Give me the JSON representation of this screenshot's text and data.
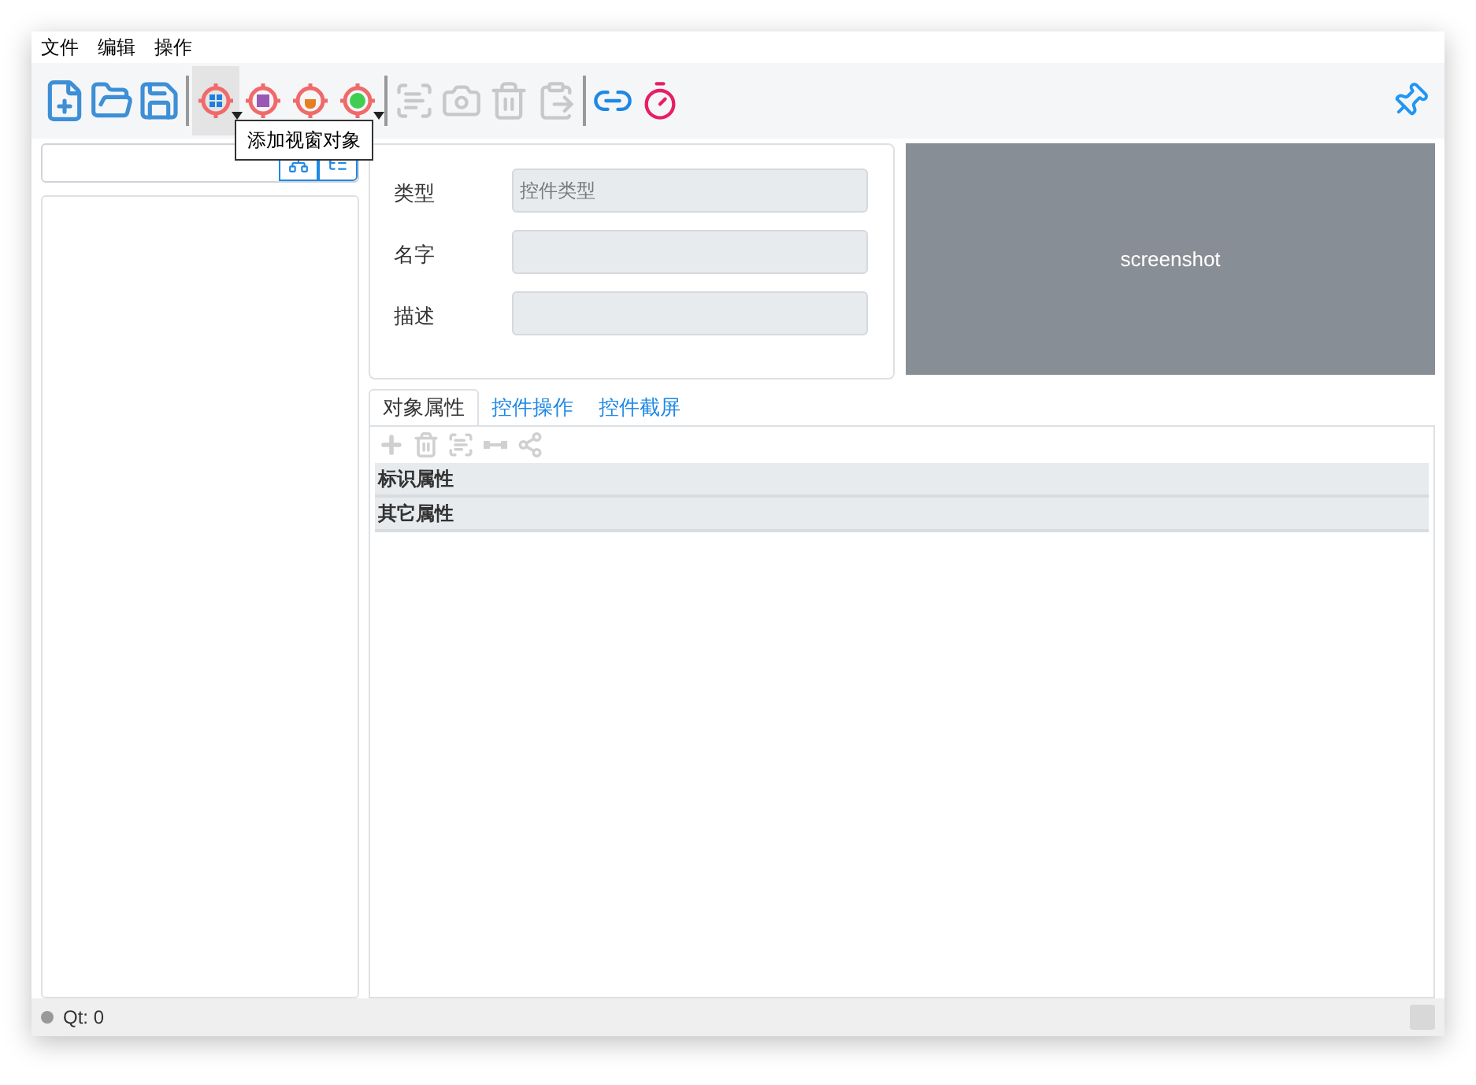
{
  "menu": [
    "文件",
    "编辑",
    "操作"
  ],
  "toolbar": [
    {
      "kind": "new",
      "disabled": false,
      "selected": false,
      "dropdown": false
    },
    {
      "kind": "open",
      "disabled": false,
      "selected": false,
      "dropdown": false
    },
    {
      "kind": "save",
      "disabled": false,
      "selected": false,
      "dropdown": false
    },
    {
      "kind": "separator"
    },
    {
      "kind": "target-window",
      "disabled": false,
      "selected": true,
      "dropdown": true
    },
    {
      "kind": "target-image",
      "disabled": false,
      "selected": false,
      "dropdown": false
    },
    {
      "kind": "target-java",
      "disabled": false,
      "selected": false,
      "dropdown": false
    },
    {
      "kind": "target-qt",
      "disabled": false,
      "selected": false,
      "dropdown": true
    },
    {
      "kind": "separator"
    },
    {
      "kind": "capture",
      "disabled": true,
      "selected": false,
      "dropdown": false
    },
    {
      "kind": "camera",
      "disabled": true,
      "selected": false,
      "dropdown": false
    },
    {
      "kind": "delete",
      "disabled": true,
      "selected": false,
      "dropdown": false
    },
    {
      "kind": "paste",
      "disabled": true,
      "selected": false,
      "dropdown": false
    },
    {
      "kind": "separator"
    },
    {
      "kind": "link",
      "disabled": false,
      "selected": false,
      "dropdown": false
    },
    {
      "kind": "timer",
      "disabled": false,
      "selected": false,
      "dropdown": false
    }
  ],
  "tooltip": "添加视窗对象",
  "form": [
    {
      "label": "类型",
      "placeholder": "控件类型"
    },
    {
      "label": "名字"
    },
    {
      "label": "描述"
    }
  ],
  "screenshot": {
    "text": "screenshot"
  },
  "tabs": [
    {
      "label": "对象属性",
      "selected": true
    },
    {
      "label": "控件操作",
      "selected": false
    },
    {
      "label": "控件截屏",
      "selected": false
    }
  ],
  "prop_toolbar": [
    {
      "kind": "add",
      "disabled": true
    },
    {
      "kind": "delete",
      "disabled": true
    },
    {
      "kind": "capture",
      "disabled": true
    },
    {
      "kind": "connect",
      "disabled": true
    },
    {
      "kind": "share",
      "disabled": true
    }
  ],
  "groups": [
    "标识属性",
    "其它属性"
  ],
  "status": {
    "text": "Qt: 0"
  }
}
